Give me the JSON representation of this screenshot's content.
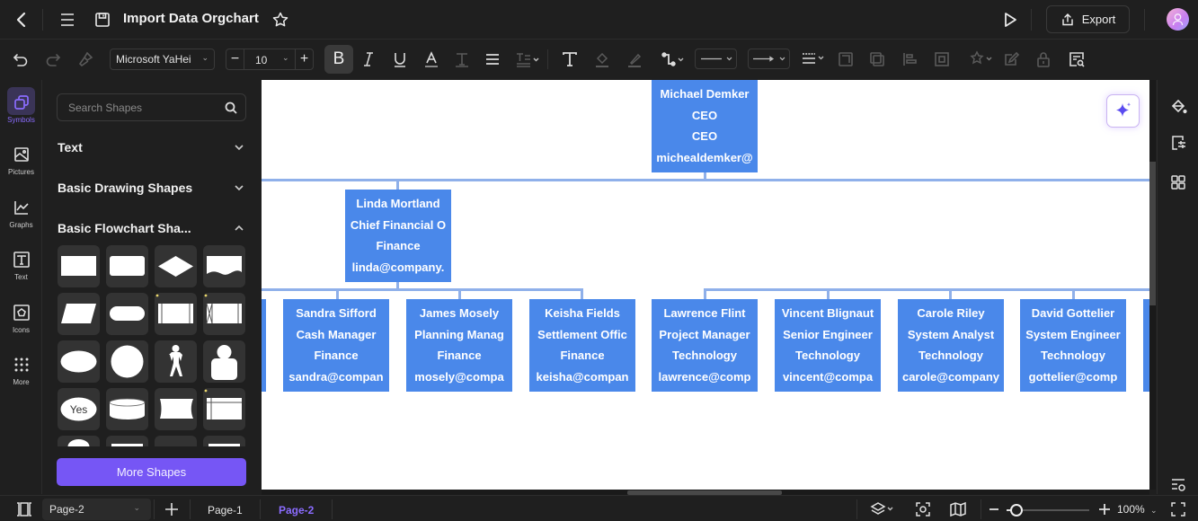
{
  "header": {
    "title": "Import Data Orgchart",
    "export_label": "Export"
  },
  "toolbar": {
    "font_family": "Microsoft YaHei",
    "font_size": "10"
  },
  "leftnav": {
    "items": [
      {
        "label": "Symbols",
        "icon": "symbols-icon",
        "active": true
      },
      {
        "label": "Pictures",
        "icon": "pictures-icon"
      },
      {
        "label": "Graphs",
        "icon": "graphs-icon"
      },
      {
        "label": "Text",
        "icon": "text-icon"
      },
      {
        "label": "Icons",
        "icon": "icons-icon"
      },
      {
        "label": "More",
        "icon": "more-grid-icon"
      }
    ]
  },
  "panel": {
    "search_placeholder": "Search Shapes",
    "sections": [
      {
        "label": "Text",
        "expanded": false
      },
      {
        "label": "Basic Drawing Shapes",
        "expanded": false
      },
      {
        "label": "Basic Flowchart Sha...",
        "expanded": true
      }
    ],
    "shapes": [
      "process",
      "rounded-rectangle",
      "decision",
      "document",
      "data",
      "terminator",
      "predefined-process",
      "stored-data-process",
      "ellipse",
      "circle",
      "actor",
      "user",
      "yes-ellipse",
      "cylinder",
      "card",
      "internal-storage"
    ],
    "yes_label": "Yes",
    "more_shapes_label": "More Shapes"
  },
  "orgchart": {
    "root": {
      "name": "Michael Demker",
      "title": "CEO",
      "department": "CEO",
      "email": "michealdemker@"
    },
    "level2": [
      {
        "name": "Linda Mortland",
        "title": "Chief Financial O",
        "department": "Finance",
        "email": "linda@company."
      }
    ],
    "level3": [
      {
        "name": "Sandra Sifford",
        "title": "Cash Manager",
        "department": "Finance",
        "email": "sandra@compan"
      },
      {
        "name": "James Mosely",
        "title": "Planning Manag",
        "department": "Finance",
        "email": "mosely@compa"
      },
      {
        "name": "Keisha Fields",
        "title": "Settlement Offic",
        "department": "Finance",
        "email": "keisha@compan"
      },
      {
        "name": "Lawrence Flint",
        "title": "Project Manager",
        "department": "Technology",
        "email": "lawrence@comp"
      },
      {
        "name": "Vincent Blignaut",
        "title": "Senior Engineer",
        "department": "Technology",
        "email": "vincent@compa"
      },
      {
        "name": "Carole Riley",
        "title": "System Analyst",
        "department": "Technology",
        "email": "carole@company"
      },
      {
        "name": "David Gottelier",
        "title": "System Engineer",
        "department": "Technology",
        "email": "gottelier@comp"
      }
    ]
  },
  "footer": {
    "page_select": "Page-2",
    "pages": [
      {
        "label": "Page-1",
        "active": false
      },
      {
        "label": "Page-2",
        "active": true
      }
    ],
    "zoom_level": "100%"
  },
  "colors": {
    "accent": "#7656f5",
    "node_fill": "#4a88ea",
    "connector": "#8fb0ea"
  }
}
